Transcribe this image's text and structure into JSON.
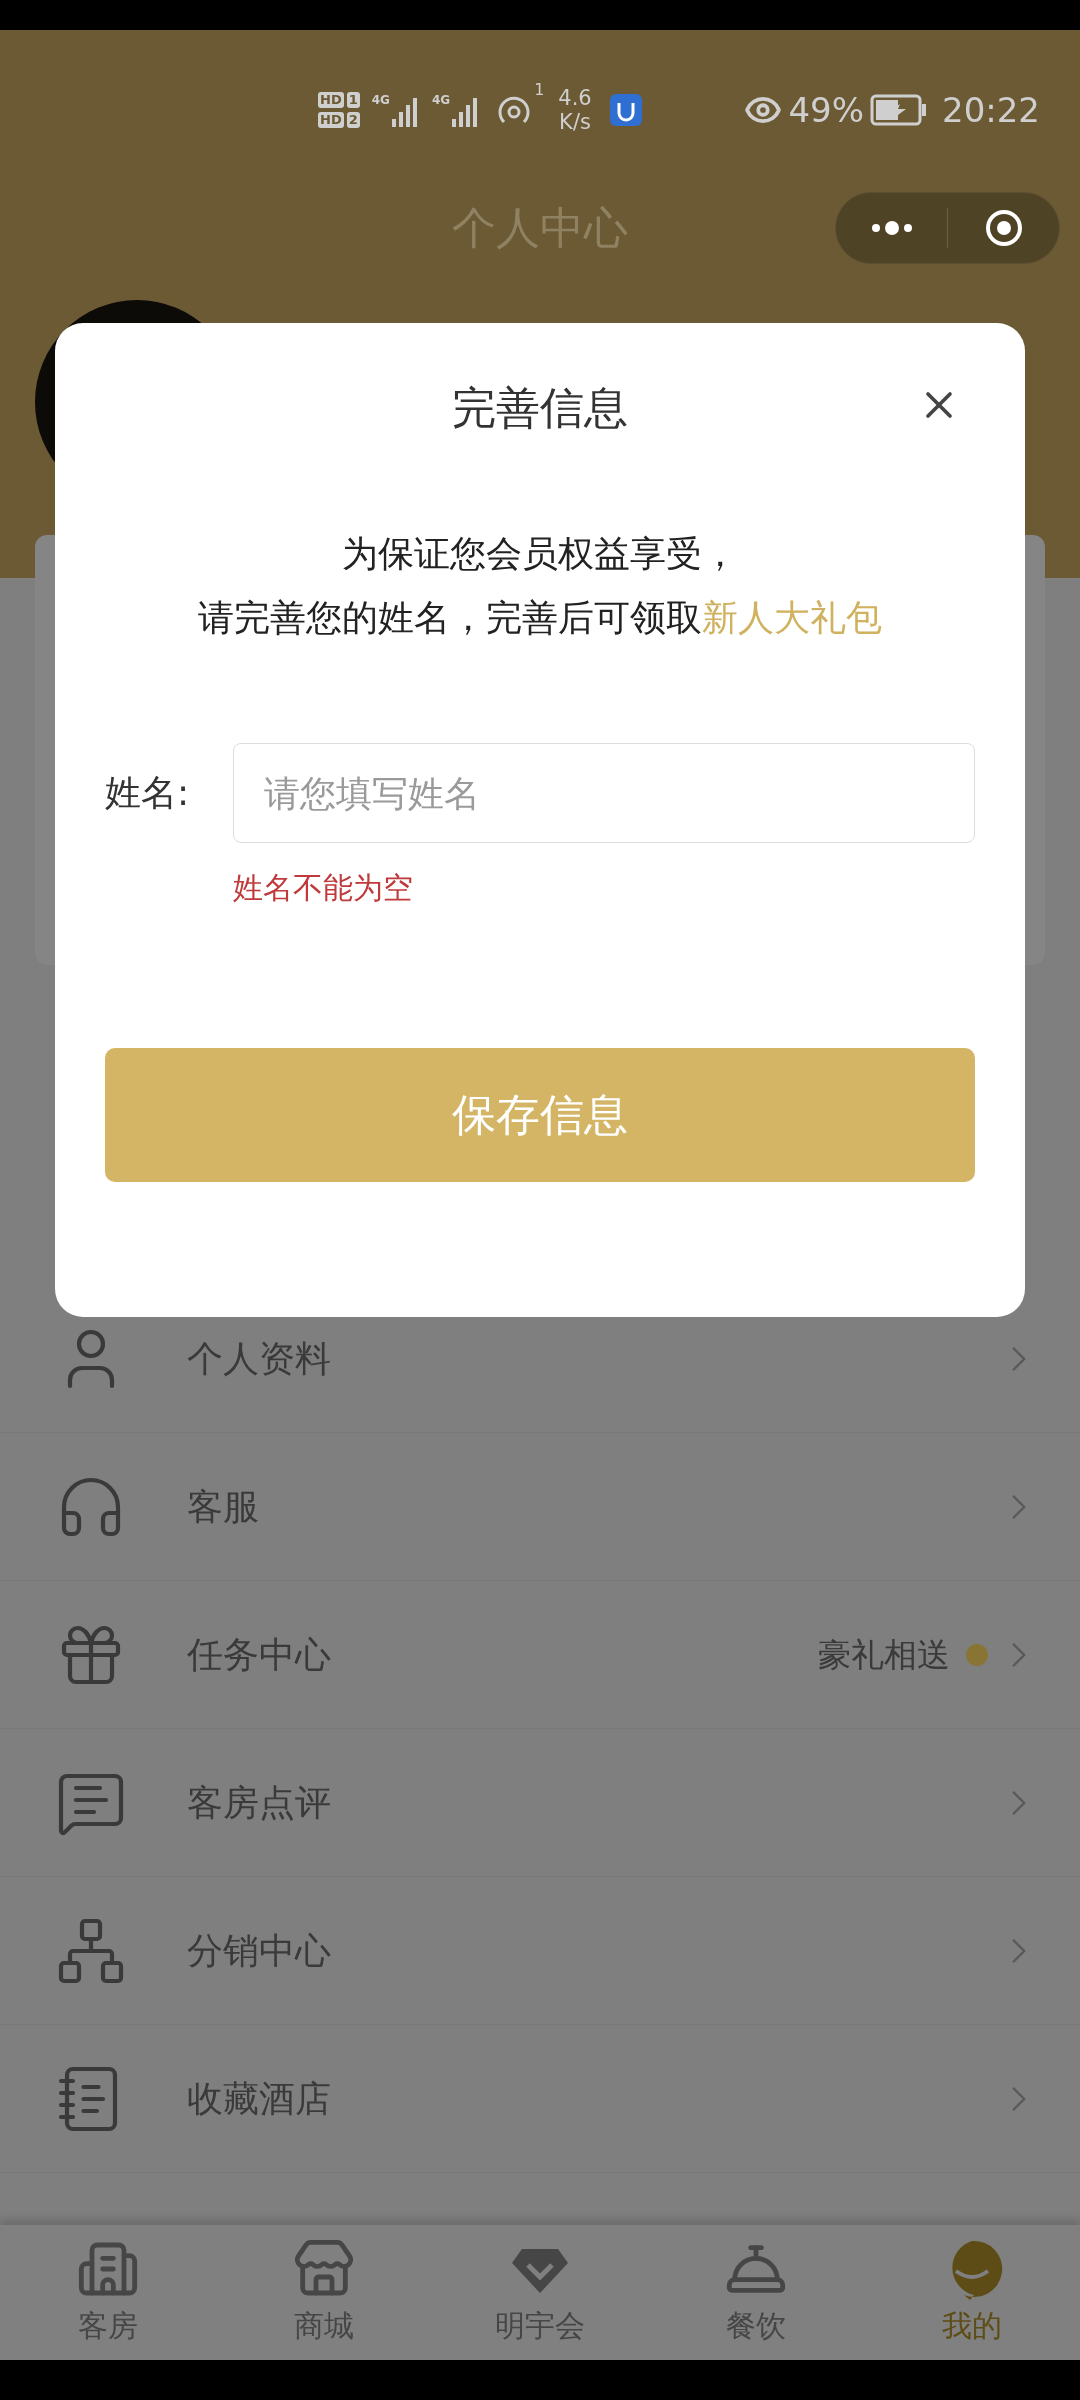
{
  "status_bar": {
    "sims": [
      {
        "label": "HD",
        "index": "1"
      },
      {
        "label": "HD",
        "index": "2"
      }
    ],
    "networks": [
      {
        "tech": "4G"
      },
      {
        "tech": "4G"
      }
    ],
    "hotspot_count": "1",
    "speed": "4.6",
    "speed_unit": "K/s",
    "battery": "49%",
    "time": "20:22"
  },
  "nav": {
    "title": "个人中心"
  },
  "menu": [
    {
      "label": "个人资料"
    },
    {
      "label": "客服"
    },
    {
      "label": "任务中心",
      "badge": {
        "text": "豪礼相送",
        "color": "#8a7434"
      }
    },
    {
      "label": "客房点评"
    },
    {
      "label": "分销中心"
    },
    {
      "label": "收藏酒店"
    }
  ],
  "tabbar": [
    {
      "label": "客房",
      "selected": false
    },
    {
      "label": "商城",
      "selected": false
    },
    {
      "label": "明宇会",
      "selected": false
    },
    {
      "label": "餐饮",
      "selected": false
    },
    {
      "label": "我的",
      "selected": true
    }
  ],
  "modal": {
    "title": "完善信息",
    "message_line1": "为保证您会员权益享受，",
    "message_line2": "请完善您的姓名，完善后可领取**新人大礼包**",
    "field_label": "姓名:",
    "field_placeholder": "请您填写姓名",
    "error": "姓名不能为空",
    "button": "保存信息"
  }
}
